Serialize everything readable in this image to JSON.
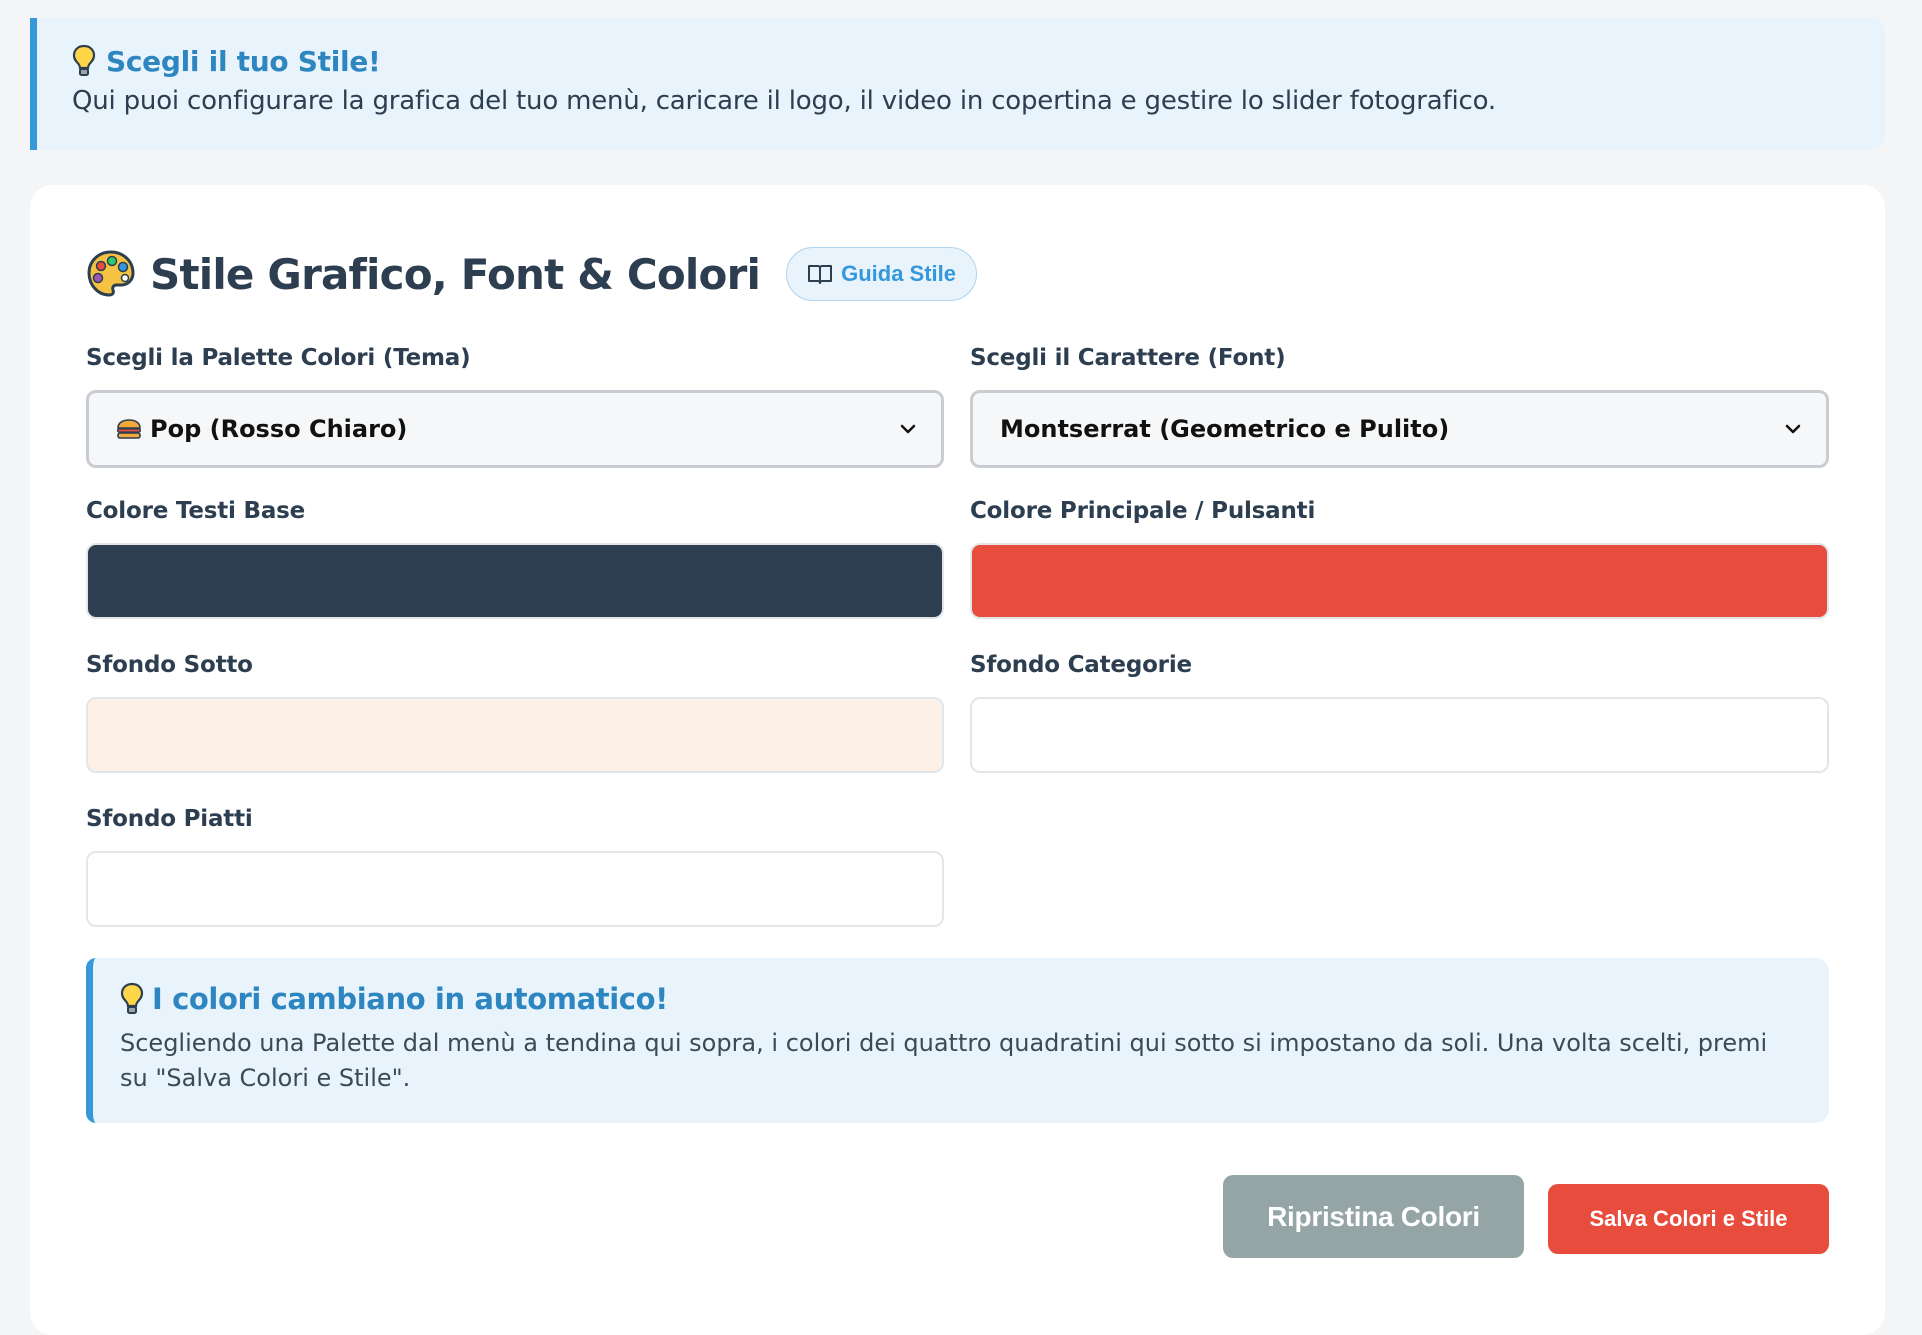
{
  "banner": {
    "title": "Scegli il tuo Stile!",
    "text": "Qui puoi configurare la grafica del tuo menù, caricare il logo, il video in copertina e gestire lo slider fotografico."
  },
  "section": {
    "title": "Stile Grafico, Font & Colori",
    "guide_button": "Guida Stile"
  },
  "fields": {
    "palette": {
      "label": "Scegli la Palette Colori (Tema)",
      "value": "Pop (Rosso Chiaro)"
    },
    "font": {
      "label": "Scegli il Carattere (Font)",
      "value": "Montserrat (Geometrico e Pulito)"
    },
    "text_color": {
      "label": "Colore Testi Base",
      "color": "#2c3e50"
    },
    "primary_color": {
      "label": "Colore Principale / Pulsanti",
      "color": "#e74c3c"
    },
    "bg_bottom": {
      "label": "Sfondo Sotto",
      "color": "#fdf0e7"
    },
    "bg_categories": {
      "label": "Sfondo Categorie",
      "color": "#ffffff"
    },
    "bg_dishes": {
      "label": "Sfondo Piatti",
      "color": "#ffffff"
    }
  },
  "tip": {
    "title": "I colori cambiano in automatico!",
    "text": "Scegliendo una Palette dal menù a tendina qui sopra, i colori dei quattro quadratini qui sotto si impostano da soli. Una volta scelti, premi su \"Salva Colori e Stile\"."
  },
  "actions": {
    "reset": "Ripristina Colori",
    "save": "Salva Colori e Stile"
  },
  "icons": {
    "bulb": "lightbulb-icon",
    "palette": "palette-icon",
    "book": "book-icon",
    "burger": "burger-icon",
    "chevron": "chevron-down-icon"
  }
}
